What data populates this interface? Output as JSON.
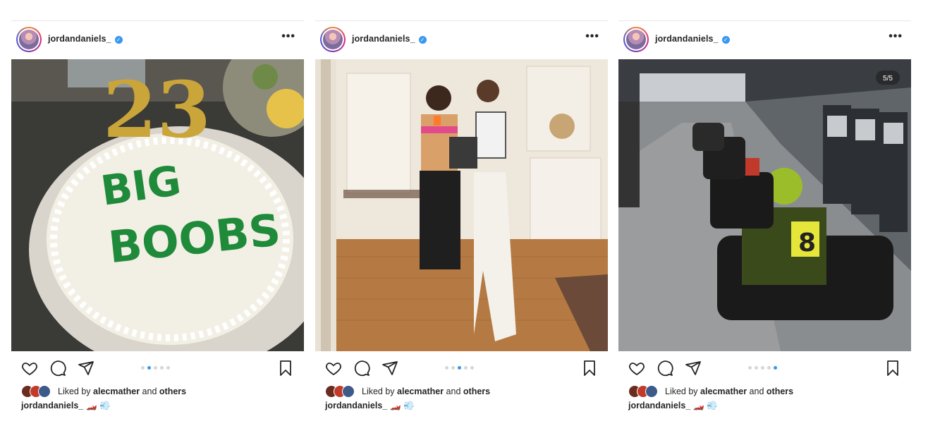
{
  "posts": [
    {
      "username": "jordandaniels_",
      "more_label": "•••",
      "photo_desc": "Birthday cake with 23 candles",
      "cake_text_line1": "BIG",
      "cake_text_line2": "BOOBS",
      "candles": "23",
      "carousel": {
        "count": 5,
        "active": 2
      },
      "likes": {
        "prefix": "Liked by",
        "user": "alecmather",
        "mid": "and",
        "others": "others"
      },
      "caption": {
        "user": "jordandaniels_",
        "emoji": "🏎️ 💨"
      }
    },
    {
      "username": "jordandaniels_",
      "more_label": "•••",
      "carousel": {
        "count": 5,
        "active": 3
      },
      "likes": {
        "prefix": "Liked by",
        "user": "alecmather",
        "mid": "and",
        "others": "others"
      },
      "caption": {
        "user": "jordandaniels_",
        "emoji": "🏎️ 💨"
      }
    },
    {
      "username": "jordandaniels_",
      "more_label": "•••",
      "counter": "5/5",
      "kart_number": "8",
      "carousel": {
        "count": 5,
        "active": 5
      },
      "likes": {
        "prefix": "Liked by",
        "user": "alecmather",
        "mid": "and",
        "others": "others"
      },
      "caption": {
        "user": "jordandaniels_",
        "emoji": "🏎️ 💨"
      }
    }
  ],
  "icons": {
    "like": "heart-icon",
    "comment": "comment-icon",
    "share": "paper-plane-icon",
    "save": "bookmark-icon",
    "more": "more-icon",
    "verified": "verified-badge-icon"
  },
  "colors": {
    "accent": "#3897f0",
    "text": "#262626",
    "dot_inactive": "#d6d6d6"
  }
}
